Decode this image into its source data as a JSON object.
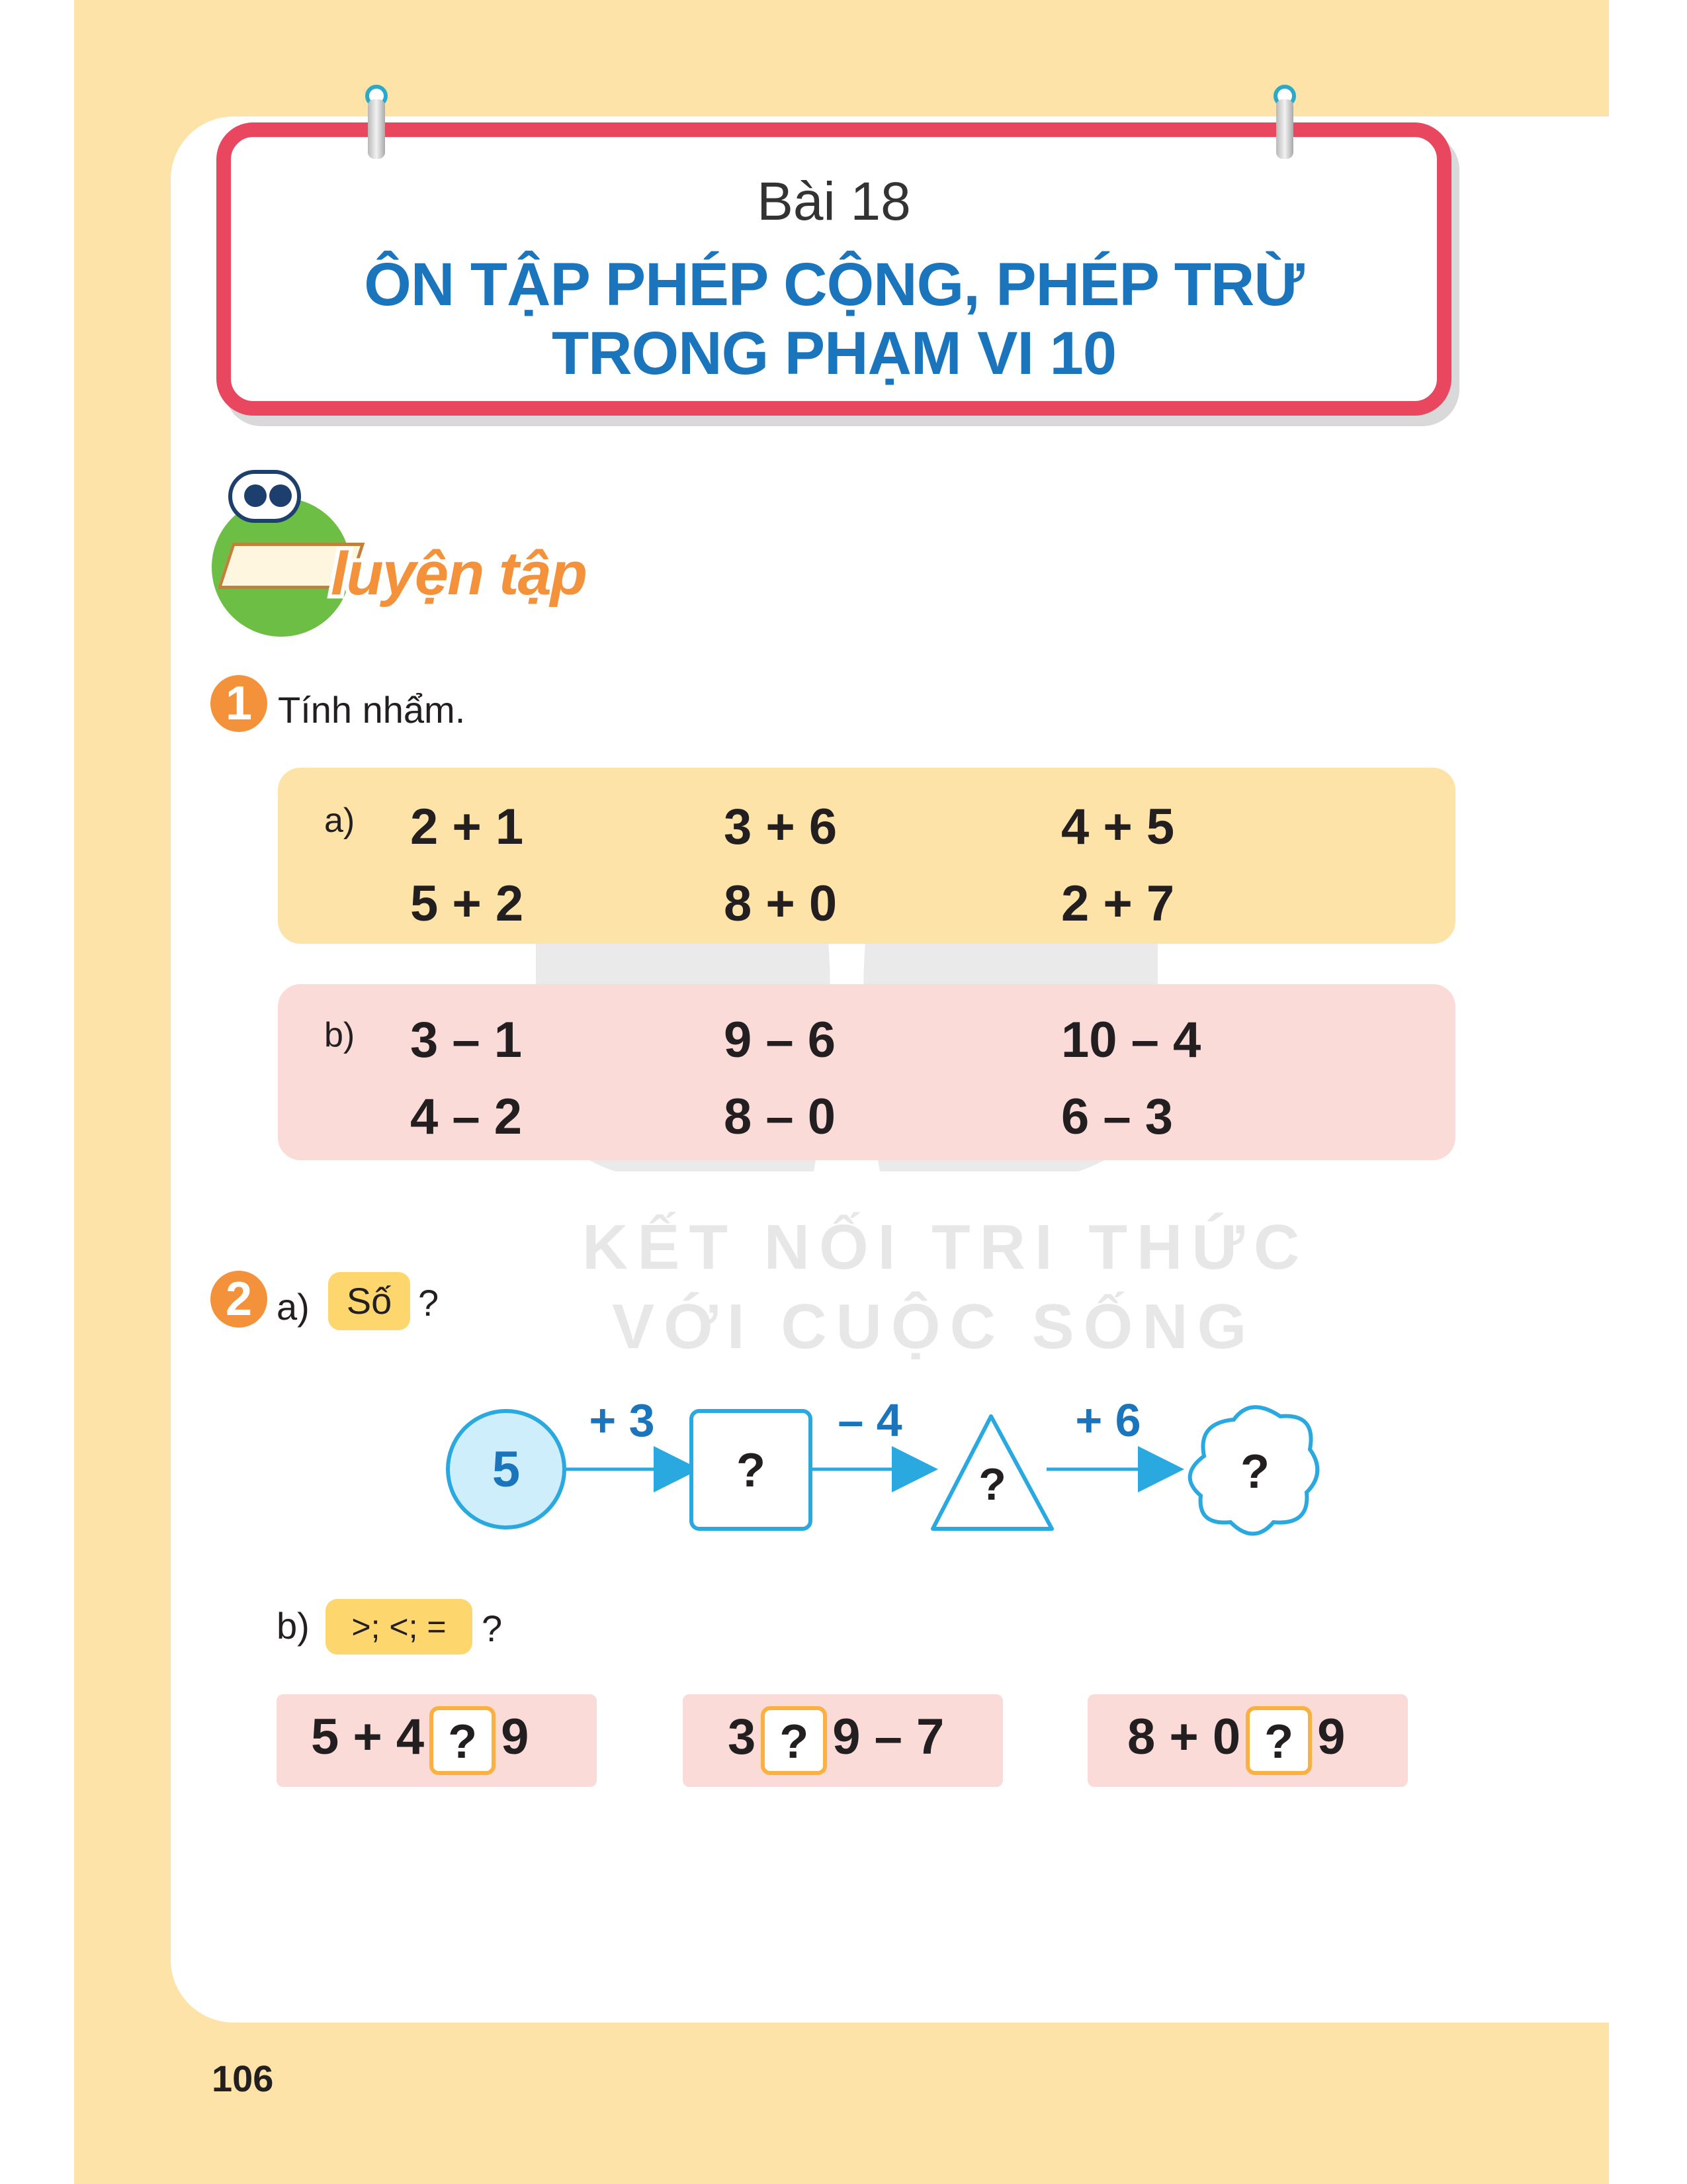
{
  "header": {
    "lesson_number": "Bài 18",
    "title_line1": "ÔN TẬP PHÉP CỘNG, PHÉP TRỪ",
    "title_line2": "TRONG PHẠM VI 10"
  },
  "section": {
    "badge_label": "luyện tập",
    "icon": "robot-reading-book-icon"
  },
  "exercise1": {
    "number": "1",
    "instruction": "Tính nhẩm.",
    "part_a": {
      "label": "a)",
      "rows": [
        [
          "2 + 1",
          "3 + 6",
          "4 + 5"
        ],
        [
          "5 + 2",
          "8 + 0",
          "2 + 7"
        ]
      ]
    },
    "part_b": {
      "label": "b)",
      "rows": [
        [
          "3 – 1",
          "9 – 6",
          "10 – 4"
        ],
        [
          "4 – 2",
          "8 – 0",
          "6 – 3"
        ]
      ]
    }
  },
  "watermark": {
    "line1": "KẾT NỐI TRI THỨC",
    "line2": "VỚI CUỘC SỐNG"
  },
  "exercise2": {
    "number": "2",
    "part_a": {
      "label": "a)",
      "tag": "Số",
      "question_mark": "?",
      "chain": {
        "start": "5",
        "op1": "+ 3",
        "box1": "?",
        "op2": "– 4",
        "box2": "?",
        "op3": "+ 6",
        "box3": "?"
      }
    },
    "part_b": {
      "label": "b)",
      "tag": ">; <; =",
      "question_mark": "?",
      "items": [
        {
          "left": "5 + 4",
          "blank": "?",
          "right": "9"
        },
        {
          "left": "3",
          "blank": "?",
          "right": "9 – 7"
        },
        {
          "left": "8 + 0",
          "blank": "?",
          "right": "9"
        }
      ]
    }
  },
  "footer": {
    "page_number": "106"
  },
  "colors": {
    "title_blue": "#1b75bc",
    "frame_red": "#e8475f",
    "band_yellow": "#fde3a7",
    "band_pink": "#fadbd8",
    "accent_orange": "#f3923b",
    "badge_green": "#6cbf44",
    "diagram_blue": "#2aa9e0"
  }
}
